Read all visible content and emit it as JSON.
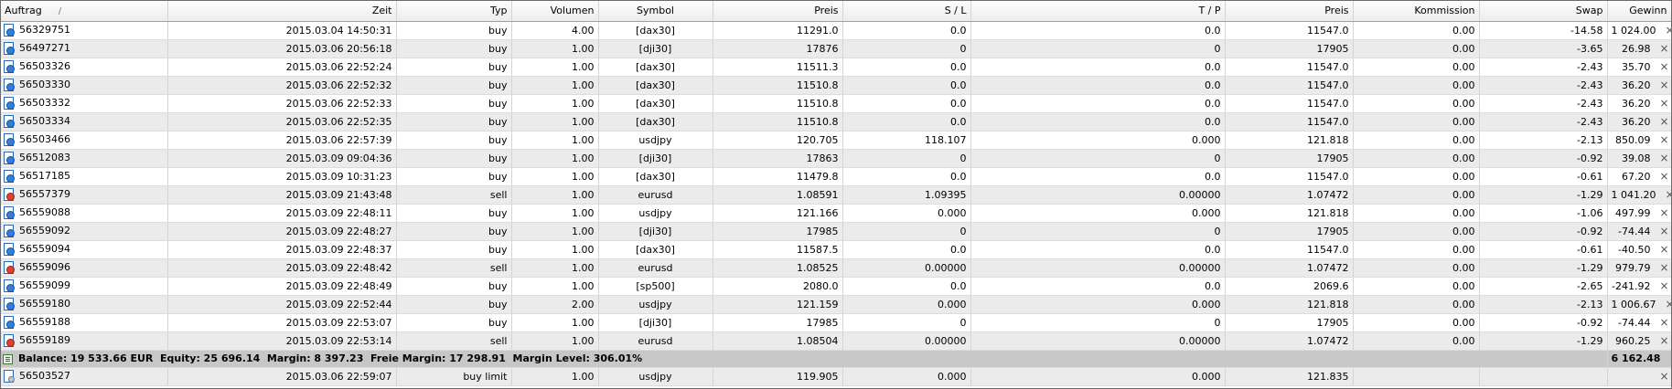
{
  "headers": {
    "order": "Auftrag",
    "sort_mark": "/",
    "time": "Zeit",
    "type": "Typ",
    "volume": "Volumen",
    "symbol": "Symbol",
    "price_open": "Preis",
    "sl": "S / L",
    "tp": "T / P",
    "price_current": "Preis",
    "commission": "Kommission",
    "swap": "Swap",
    "profit": "Gewinn"
  },
  "icons": {
    "buy": "buy-order-icon",
    "sell": "sell-order-icon",
    "pending": "pending-order-icon",
    "balance": "balance-icon",
    "close": "close-icon"
  },
  "close_glyph": "×",
  "orders": [
    {
      "order": "56329751",
      "time": "2015.03.04 14:50:31",
      "type": "buy",
      "volume": "4.00",
      "symbol": "[dax30]",
      "price_open": "11291.0",
      "sl": "0.0",
      "tp": "0.0",
      "price_current": "11547.0",
      "commission": "0.00",
      "swap": "-14.58",
      "profit": "1 024.00"
    },
    {
      "order": "56497271",
      "time": "2015.03.06 20:56:18",
      "type": "buy",
      "volume": "1.00",
      "symbol": "[dji30]",
      "price_open": "17876",
      "sl": "0",
      "tp": "0",
      "price_current": "17905",
      "commission": "0.00",
      "swap": "-3.65",
      "profit": "26.98"
    },
    {
      "order": "56503326",
      "time": "2015.03.06 22:52:24",
      "type": "buy",
      "volume": "1.00",
      "symbol": "[dax30]",
      "price_open": "11511.3",
      "sl": "0.0",
      "tp": "0.0",
      "price_current": "11547.0",
      "commission": "0.00",
      "swap": "-2.43",
      "profit": "35.70"
    },
    {
      "order": "56503330",
      "time": "2015.03.06 22:52:32",
      "type": "buy",
      "volume": "1.00",
      "symbol": "[dax30]",
      "price_open": "11510.8",
      "sl": "0.0",
      "tp": "0.0",
      "price_current": "11547.0",
      "commission": "0.00",
      "swap": "-2.43",
      "profit": "36.20"
    },
    {
      "order": "56503332",
      "time": "2015.03.06 22:52:33",
      "type": "buy",
      "volume": "1.00",
      "symbol": "[dax30]",
      "price_open": "11510.8",
      "sl": "0.0",
      "tp": "0.0",
      "price_current": "11547.0",
      "commission": "0.00",
      "swap": "-2.43",
      "profit": "36.20"
    },
    {
      "order": "56503334",
      "time": "2015.03.06 22:52:35",
      "type": "buy",
      "volume": "1.00",
      "symbol": "[dax30]",
      "price_open": "11510.8",
      "sl": "0.0",
      "tp": "0.0",
      "price_current": "11547.0",
      "commission": "0.00",
      "swap": "-2.43",
      "profit": "36.20"
    },
    {
      "order": "56503466",
      "time": "2015.03.06 22:57:39",
      "type": "buy",
      "volume": "1.00",
      "symbol": "usdjpy",
      "price_open": "120.705",
      "sl": "118.107",
      "tp": "0.000",
      "price_current": "121.818",
      "commission": "0.00",
      "swap": "-2.13",
      "profit": "850.09"
    },
    {
      "order": "56512083",
      "time": "2015.03.09 09:04:36",
      "type": "buy",
      "volume": "1.00",
      "symbol": "[dji30]",
      "price_open": "17863",
      "sl": "0",
      "tp": "0",
      "price_current": "17905",
      "commission": "0.00",
      "swap": "-0.92",
      "profit": "39.08"
    },
    {
      "order": "56517185",
      "time": "2015.03.09 10:31:23",
      "type": "buy",
      "volume": "1.00",
      "symbol": "[dax30]",
      "price_open": "11479.8",
      "sl": "0.0",
      "tp": "0.0",
      "price_current": "11547.0",
      "commission": "0.00",
      "swap": "-0.61",
      "profit": "67.20"
    },
    {
      "order": "56557379",
      "time": "2015.03.09 21:43:48",
      "type": "sell",
      "volume": "1.00",
      "symbol": "eurusd",
      "price_open": "1.08591",
      "sl": "1.09395",
      "tp": "0.00000",
      "price_current": "1.07472",
      "commission": "0.00",
      "swap": "-1.29",
      "profit": "1 041.20"
    },
    {
      "order": "56559088",
      "time": "2015.03.09 22:48:11",
      "type": "buy",
      "volume": "1.00",
      "symbol": "usdjpy",
      "price_open": "121.166",
      "sl": "0.000",
      "tp": "0.000",
      "price_current": "121.818",
      "commission": "0.00",
      "swap": "-1.06",
      "profit": "497.99"
    },
    {
      "order": "56559092",
      "time": "2015.03.09 22:48:27",
      "type": "buy",
      "volume": "1.00",
      "symbol": "[dji30]",
      "price_open": "17985",
      "sl": "0",
      "tp": "0",
      "price_current": "17905",
      "commission": "0.00",
      "swap": "-0.92",
      "profit": "-74.44"
    },
    {
      "order": "56559094",
      "time": "2015.03.09 22:48:37",
      "type": "buy",
      "volume": "1.00",
      "symbol": "[dax30]",
      "price_open": "11587.5",
      "sl": "0.0",
      "tp": "0.0",
      "price_current": "11547.0",
      "commission": "0.00",
      "swap": "-0.61",
      "profit": "-40.50"
    },
    {
      "order": "56559096",
      "time": "2015.03.09 22:48:42",
      "type": "sell",
      "volume": "1.00",
      "symbol": "eurusd",
      "price_open": "1.08525",
      "sl": "0.00000",
      "tp": "0.00000",
      "price_current": "1.07472",
      "commission": "0.00",
      "swap": "-1.29",
      "profit": "979.79"
    },
    {
      "order": "56559099",
      "time": "2015.03.09 22:48:49",
      "type": "buy",
      "volume": "1.00",
      "symbol": "[sp500]",
      "price_open": "2080.0",
      "sl": "0.0",
      "tp": "0.0",
      "price_current": "2069.6",
      "commission": "0.00",
      "swap": "-2.65",
      "profit": "-241.92"
    },
    {
      "order": "56559180",
      "time": "2015.03.09 22:52:44",
      "type": "buy",
      "volume": "2.00",
      "symbol": "usdjpy",
      "price_open": "121.159",
      "sl": "0.000",
      "tp": "0.000",
      "price_current": "121.818",
      "commission": "0.00",
      "swap": "-2.13",
      "profit": "1 006.67"
    },
    {
      "order": "56559188",
      "time": "2015.03.09 22:53:07",
      "type": "buy",
      "volume": "1.00",
      "symbol": "[dji30]",
      "price_open": "17985",
      "sl": "0",
      "tp": "0",
      "price_current": "17905",
      "commission": "0.00",
      "swap": "-0.92",
      "profit": "-74.44"
    },
    {
      "order": "56559189",
      "time": "2015.03.09 22:53:14",
      "type": "sell",
      "volume": "1.00",
      "symbol": "eurusd",
      "price_open": "1.08504",
      "sl": "0.00000",
      "tp": "0.00000",
      "price_current": "1.07472",
      "commission": "0.00",
      "swap": "-1.29",
      "profit": "960.25"
    }
  ],
  "summary": {
    "text": "Balance: 19 533.66 EUR  Equity: 25 696.14  Margin: 8 397.23  Freie Margin: 17 298.91  Margin Level: 306.01%",
    "total_profit": "6 162.48"
  },
  "pending": [
    {
      "order": "56503527",
      "time": "2015.03.06 22:59:07",
      "type": "buy limit",
      "volume": "1.00",
      "symbol": "usdjpy",
      "price_open": "119.905",
      "sl": "0.000",
      "tp": "0.000",
      "price_current": "121.835",
      "commission": "",
      "swap": "",
      "profit": ""
    }
  ]
}
